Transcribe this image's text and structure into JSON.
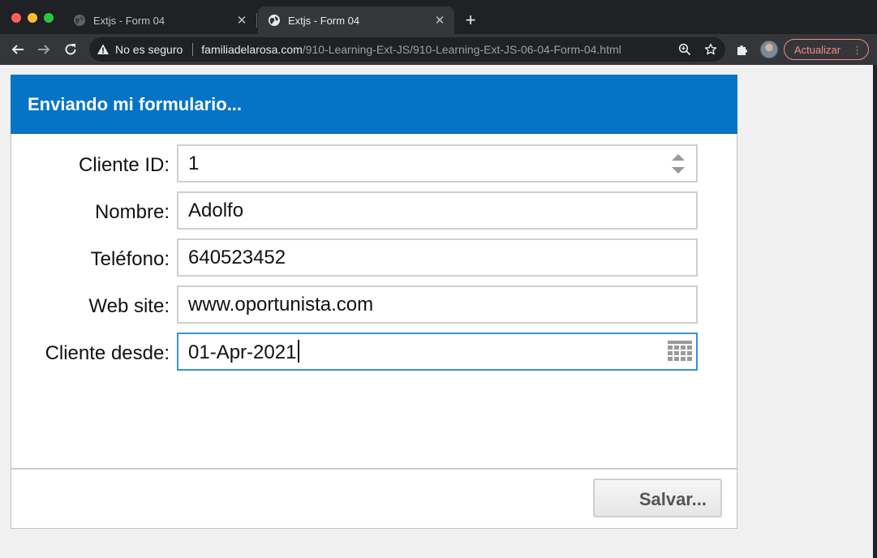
{
  "browser": {
    "tabs": [
      {
        "title": "Extjs - Form 04",
        "active": false
      },
      {
        "title": "Extjs - Form 04",
        "active": true
      }
    ],
    "security_label": "No es seguro",
    "url_host": "familiadelarosa.com",
    "url_path": "/910-Learning-Ext-JS/910-Learning-Ext-JS-06-04-Form-04.html",
    "update_label": "Actualizar",
    "update_color": "#f28b82"
  },
  "form": {
    "title": "Enviando mi formulario...",
    "header_color": "#0574c6",
    "fields": [
      {
        "label": "Cliente ID:",
        "value": "1",
        "type": "number"
      },
      {
        "label": "Nombre:",
        "value": "Adolfo",
        "type": "text"
      },
      {
        "label": "Teléfono:",
        "value": "640523452",
        "type": "text"
      },
      {
        "label": "Web site:",
        "value": "www.oportunista.com",
        "type": "text"
      },
      {
        "label": "Cliente desde:",
        "value": "01-Apr-2021",
        "type": "date",
        "focused": true
      }
    ],
    "save_label": "Salvar..."
  }
}
